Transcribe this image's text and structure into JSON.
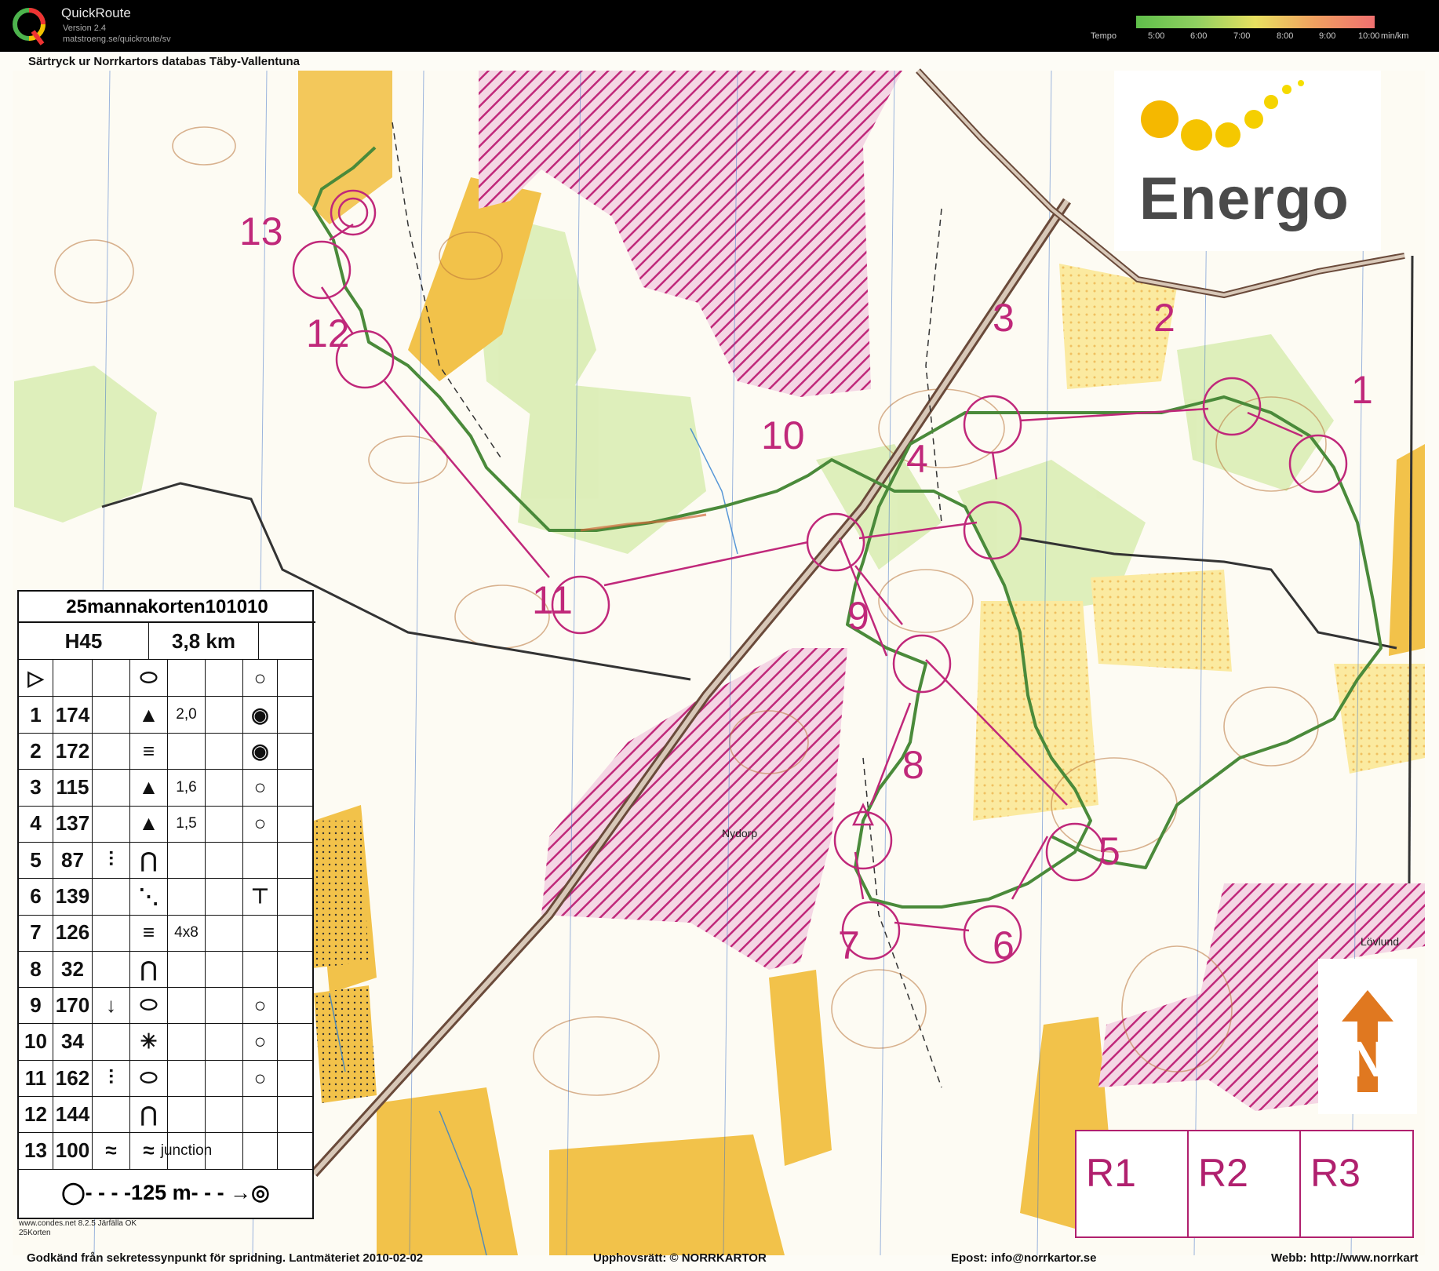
{
  "app": {
    "name": "QuickRoute",
    "version": "Version 2.4",
    "url": "matstroeng.se/quickroute/sv"
  },
  "tempo": {
    "label": "Tempo",
    "ticks": [
      "5:00",
      "6:00",
      "7:00",
      "8:00",
      "9:00",
      "10:00"
    ],
    "unit": "min/km"
  },
  "map": {
    "header": "Särtryck ur Norrkartors databas Täby-Vallentuna",
    "sponsor": "Energo",
    "place_names": [
      "Nydorp",
      "Lövlund"
    ],
    "print_lines": [
      "www.condes.net 8.2.5 Järfälla OK",
      "25Korten"
    ],
    "control_numbers": [
      "1",
      "2",
      "3",
      "4",
      "5",
      "6",
      "7",
      "8",
      "9",
      "10",
      "11",
      "12",
      "13"
    ],
    "footer": {
      "approval": "Godkänd från sekretessynpunkt  för spridning. Lantmäteriet 2010-02-02",
      "copyright": "Upphovsrätt:  © NORRKARTOR",
      "email": "Epost: info@norrkartor.se",
      "web": "Webb: http://www.norrkart"
    },
    "r_boxes": [
      "R1",
      "R2",
      "R3"
    ],
    "colors": {
      "course": "#c0287a",
      "route": "#4a8a3a",
      "yellow": "#f2c24a",
      "light_green": "#d8ecb0",
      "forbidden": "#c0287a"
    }
  },
  "description_sheet": {
    "title": "25mannakorten101010",
    "class": "H45",
    "length": "3,8 km",
    "rows": [
      {
        "num": "1",
        "code": "174",
        "col_d": "",
        "col_e": "knoll",
        "col_f": "2,0"
      },
      {
        "num": "2",
        "code": "172",
        "col_d": "",
        "col_e": "marsh",
        "col_f": ""
      },
      {
        "num": "3",
        "code": "115",
        "col_d": "",
        "col_e": "knoll",
        "col_f": "1,6"
      },
      {
        "num": "4",
        "code": "137",
        "col_d": "",
        "col_e": "knoll",
        "col_f": "1,5"
      },
      {
        "num": "5",
        "code": "87",
        "col_d": "between",
        "col_e": "spur",
        "col_f": ""
      },
      {
        "num": "6",
        "code": "139",
        "col_d": "",
        "col_e": "boulder-field",
        "col_f": ""
      },
      {
        "num": "7",
        "code": "126",
        "col_d": "",
        "col_e": "marsh",
        "col_f": "4x8"
      },
      {
        "num": "8",
        "code": "32",
        "col_d": "",
        "col_e": "spur",
        "col_f": ""
      },
      {
        "num": "9",
        "code": "170",
        "col_d": "lower",
        "col_e": "hill",
        "col_f": ""
      },
      {
        "num": "10",
        "code": "34",
        "col_d": "",
        "col_e": "spring",
        "col_f": ""
      },
      {
        "num": "11",
        "code": "162",
        "col_d": "between",
        "col_e": "hill",
        "col_f": ""
      },
      {
        "num": "12",
        "code": "144",
        "col_d": "",
        "col_e": "spur",
        "col_f": ""
      },
      {
        "num": "13",
        "code": "100",
        "col_d": "erosion",
        "col_e": "erosion",
        "col_f": "junction"
      }
    ],
    "footer": "125 m"
  }
}
